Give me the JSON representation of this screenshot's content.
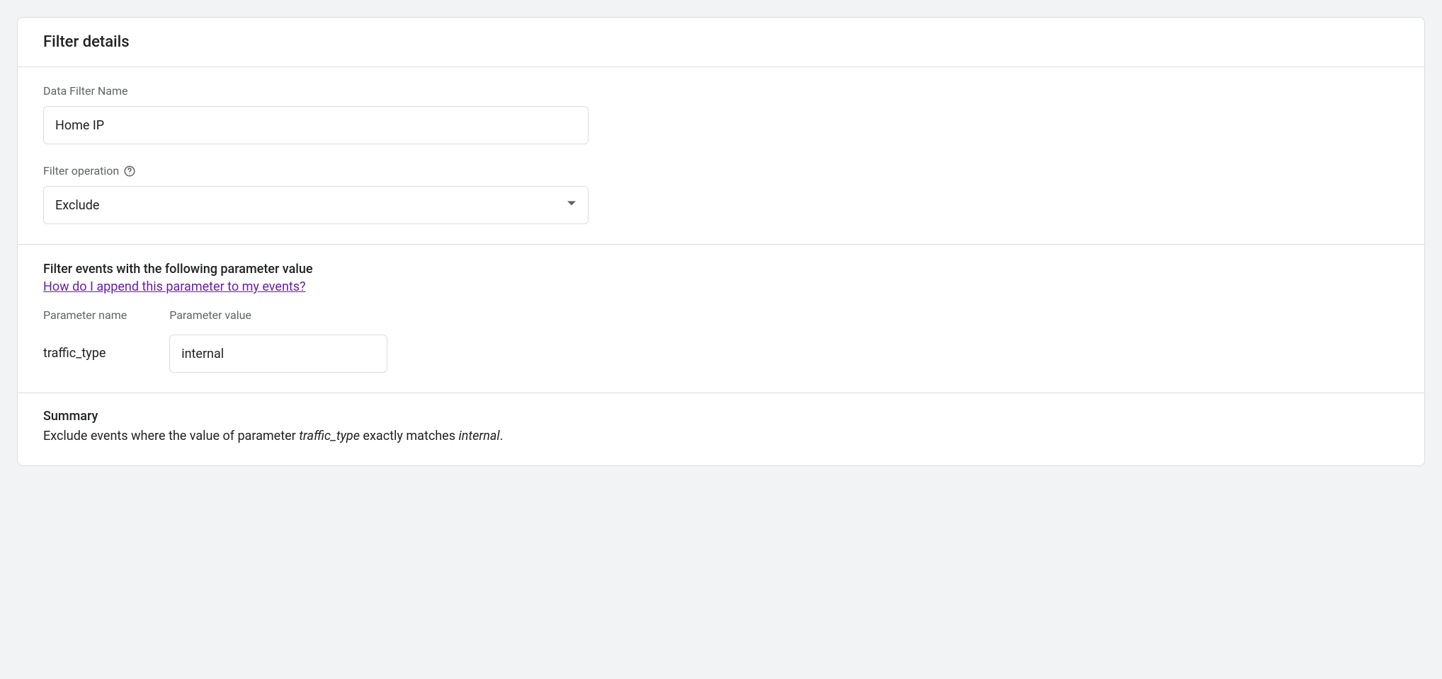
{
  "card": {
    "title": "Filter details"
  },
  "fields": {
    "name_label": "Data Filter Name",
    "name_value": "Home IP",
    "operation_label": "Filter operation",
    "operation_value": "Exclude"
  },
  "params": {
    "heading": "Filter events with the following parameter value",
    "help_link": "How do I append this parameter to my events?",
    "name_label": "Parameter name",
    "name_value": "traffic_type",
    "value_label": "Parameter value",
    "value_value": "internal"
  },
  "summary": {
    "title": "Summary",
    "prefix": "Exclude events where the value of parameter ",
    "param": "traffic_type",
    "mid": " exactly matches ",
    "val": "internal",
    "suffix": "."
  }
}
